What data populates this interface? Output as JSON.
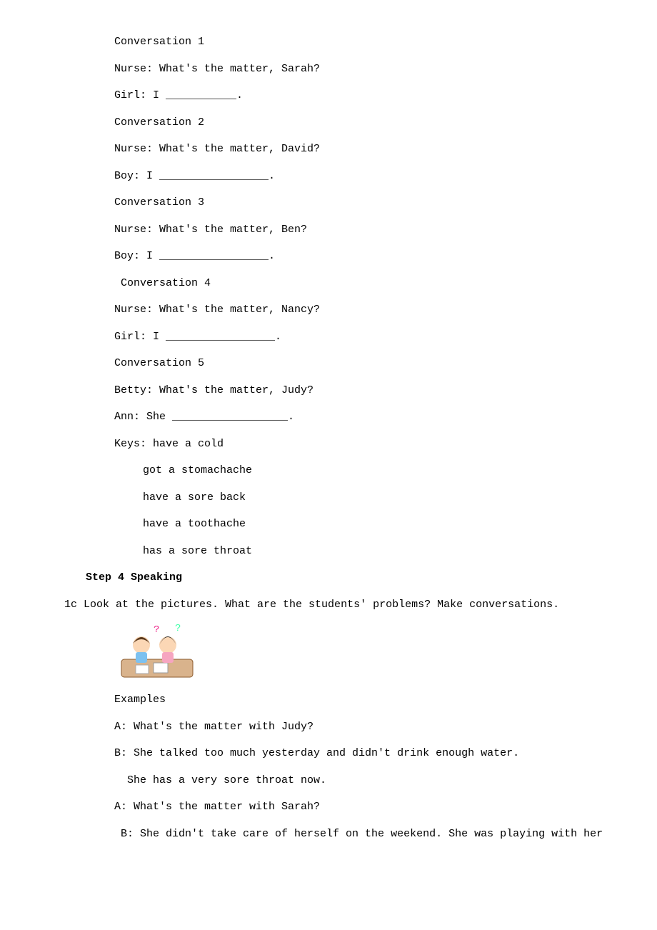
{
  "conversations": [
    {
      "title": "Conversation 1",
      "speaker1": "Nurse: What's the matter, Sarah?",
      "speaker2": "Girl: I ___________."
    },
    {
      "title": "Conversation 2",
      "speaker1": "Nurse: What's the matter, David?",
      "speaker2": "Boy: I _________________."
    },
    {
      "title": "Conversation 3",
      "speaker1": "Nurse: What's the matter, Ben?",
      "speaker2": "Boy: I _________________."
    },
    {
      "title": " Conversation 4",
      "speaker1": "Nurse: What's the matter, Nancy?",
      "speaker2": "Girl: I _________________."
    },
    {
      "title": "Conversation 5",
      "speaker1": "Betty: What's the matter, Judy?",
      "speaker2": "Ann: She __________________."
    }
  ],
  "keys_label": "Keys: have a cold",
  "keys": [
    "got a stomachache",
    "have a sore back",
    "have a toothache",
    "has a sore throat"
  ],
  "step_heading": "Step 4 Speaking",
  "instruction": "1c Look at the pictures. What are the students' problems? Make conversations.",
  "examples_label": "Examples",
  "examples": [
    "A: What's the matter with Judy?",
    "B: She talked too much yesterday and didn't drink enough water.",
    "  She has a very sore throat now.",
    "A: What's the matter with Sarah?",
    " B: She didn't take care of herself on the weekend. She was playing with her"
  ]
}
